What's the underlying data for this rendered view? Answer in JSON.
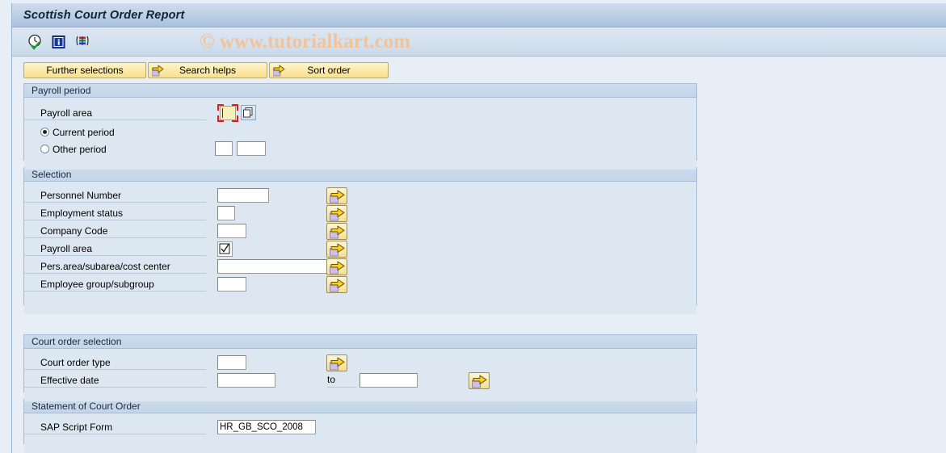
{
  "window": {
    "title": "Scottish Court Order Report"
  },
  "toolbar": {
    "icons": [
      {
        "name": "execute-clock-check-icon",
        "title": "Execute"
      },
      {
        "name": "information-icon",
        "title": "Information"
      },
      {
        "name": "variants-icon",
        "title": "Get Variant"
      }
    ],
    "watermark": "© www.tutorialkart.com"
  },
  "buttons": {
    "further_selections": "Further selections",
    "search_helps": "Search helps",
    "sort_order": "Sort order"
  },
  "payroll_period": {
    "header": "Payroll period",
    "payroll_area_label": "Payroll area",
    "payroll_area_value": "",
    "current_period_label": "Current period",
    "other_period_label": "Other period",
    "selected": "current",
    "other_period_value_1": "",
    "other_period_value_2": ""
  },
  "selection": {
    "header": "Selection",
    "rows": [
      {
        "label": "Personnel Number",
        "value": ""
      },
      {
        "label": "Employment status",
        "value": ""
      },
      {
        "label": "Company Code",
        "value": ""
      },
      {
        "label": "Payroll area",
        "value": ""
      },
      {
        "label": "Pers.area/subarea/cost center",
        "value": ""
      },
      {
        "label": "Employee group/subgroup",
        "value": ""
      }
    ]
  },
  "court_order_selection": {
    "header": "Court order selection",
    "court_order_type_label": "Court order type",
    "court_order_type_value": "",
    "effective_date_label": "Effective date",
    "effective_date_from": "",
    "to_label": "to",
    "effective_date_to": ""
  },
  "statement": {
    "header": "Statement of Court Order",
    "sap_script_form_label": "SAP Script Form",
    "sap_script_form_value": "HR_GB_SCO_2008"
  },
  "colors": {
    "background": "#e8eef5",
    "panel": "#dde7f1",
    "titlebar": "#bdd0e4",
    "button_yellow": "#fbeaa8",
    "focus_red": "#e01b1b",
    "watermark": "#f0c39a"
  }
}
